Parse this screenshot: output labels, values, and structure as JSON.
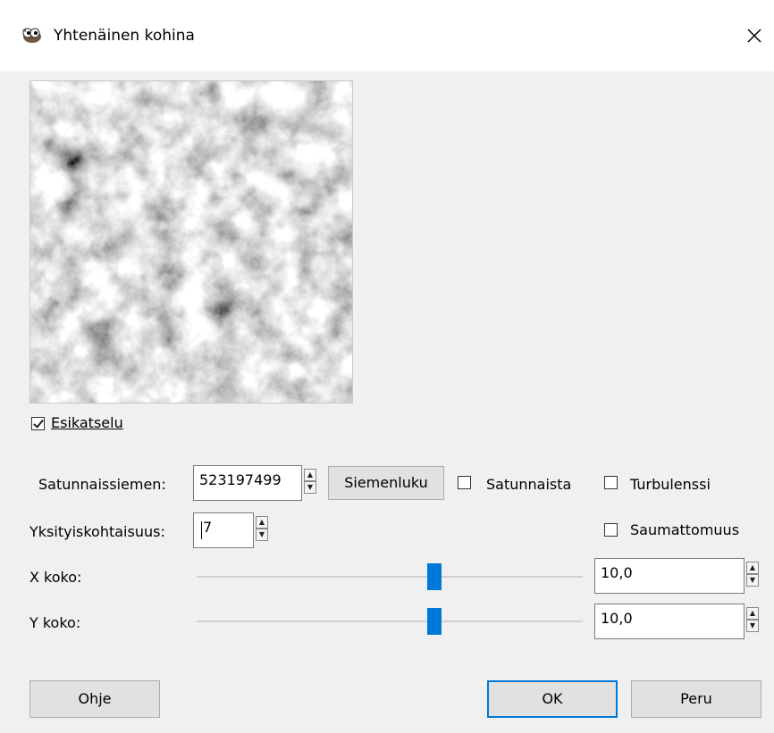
{
  "window": {
    "title": "Yhtenäinen kohina",
    "icon": "gimp-wilber-icon"
  },
  "preview": {
    "checkbox_label": "Esikatselu",
    "checked": true
  },
  "seed": {
    "label": "Satunnaissiemen:",
    "value": "523197499",
    "new_seed_button": "Siemenluku",
    "randomize_label": "Satunnaista",
    "randomize_checked": false
  },
  "turbulence": {
    "label": "Turbulenssi",
    "checked": false
  },
  "detail": {
    "label": "Yksityiskohtaisuus:",
    "value": "7"
  },
  "tileable": {
    "label": "Saumattomuus",
    "checked": false
  },
  "x_size": {
    "label": "X koko:",
    "value": "10,0",
    "slider_fraction": 0.6
  },
  "y_size": {
    "label": "Y koko:",
    "value": "10,0",
    "slider_fraction": 0.6
  },
  "buttons": {
    "help": "Ohje",
    "ok": "OK",
    "cancel": "Peru"
  },
  "colors": {
    "accent": "#0078d7",
    "dialog_bg": "#f0f0f0"
  }
}
